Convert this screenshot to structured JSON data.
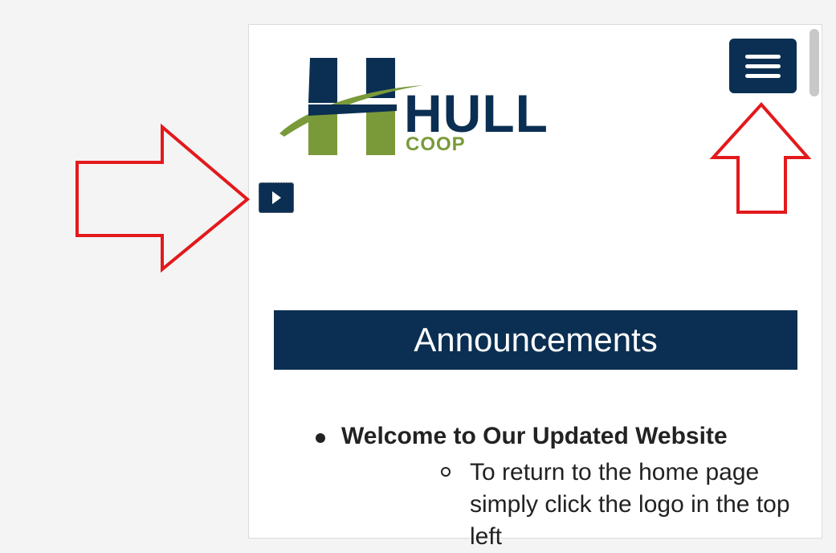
{
  "brand": {
    "name_main": "HULL",
    "name_sub": "COOP",
    "colors": {
      "navy": "#0b2f52",
      "green": "#7a9a3a"
    }
  },
  "header": {
    "menu_icon": "hamburger-menu-icon",
    "play_icon": "play-triangle-icon"
  },
  "overlays": {
    "arrow_color": "#e3191c",
    "arrows": [
      {
        "direction": "right",
        "points_to": "play-button"
      },
      {
        "direction": "up",
        "points_to": "menu-button"
      }
    ]
  },
  "announcements": {
    "heading": "Announcements",
    "items": [
      {
        "title": "Welcome to Our Updated Website",
        "sub": "To return to the home page simply click the logo in the top left"
      }
    ]
  }
}
